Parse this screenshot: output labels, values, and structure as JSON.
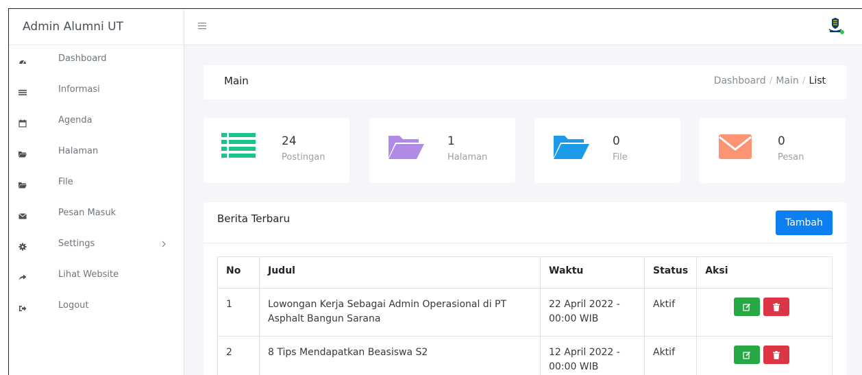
{
  "brand": "Admin Alumni UT",
  "sidebar": {
    "items": [
      {
        "label": "Dashboard",
        "icon": "dashboard-icon"
      },
      {
        "label": "Informasi",
        "icon": "list-icon"
      },
      {
        "label": "Agenda",
        "icon": "calendar-icon"
      },
      {
        "label": "Halaman",
        "icon": "folder-icon"
      },
      {
        "label": "File",
        "icon": "folder-icon"
      },
      {
        "label": "Pesan Masuk",
        "icon": "envelope-icon"
      },
      {
        "label": "Settings",
        "icon": "gear-icon"
      },
      {
        "label": "Lihat Website",
        "icon": "share-icon"
      },
      {
        "label": "Logout",
        "icon": "logout-icon"
      }
    ]
  },
  "header": {
    "title": "Main",
    "breadcrumb": [
      "Dashboard",
      "Main",
      "List"
    ]
  },
  "stats": [
    {
      "value": "24",
      "caption": "Postingan",
      "icon": "list-icon",
      "color": "#1ec28b"
    },
    {
      "value": "1",
      "caption": "Halaman",
      "icon": "folder-open-icon",
      "color": "#b08be6"
    },
    {
      "value": "0",
      "caption": "File",
      "icon": "folder-open-icon",
      "color": "#1e9be8"
    },
    {
      "value": "0",
      "caption": "Pesan",
      "icon": "envelope-icon",
      "color": "#fa9473"
    }
  ],
  "news": {
    "title": "Berita Terbaru",
    "add_label": "Tambah",
    "columns": [
      "No",
      "Judul",
      "Waktu",
      "Status",
      "Aksi"
    ],
    "rows": [
      {
        "no": "1",
        "judul": "Lowongan Kerja Sebagai Admin Operasional di PT Asphalt Bangun Sarana",
        "waktu": "22 April 2022 - 00:00 WIB",
        "status": "Aktif"
      },
      {
        "no": "2",
        "judul": "8 Tips Mendapatkan Beasiswa S2",
        "waktu": "12 April 2022 - 00:00 WIB",
        "status": "Aktif"
      }
    ]
  },
  "colors": {
    "primary": "#0d7ff0",
    "success": "#28a745",
    "danger": "#dc3545"
  }
}
